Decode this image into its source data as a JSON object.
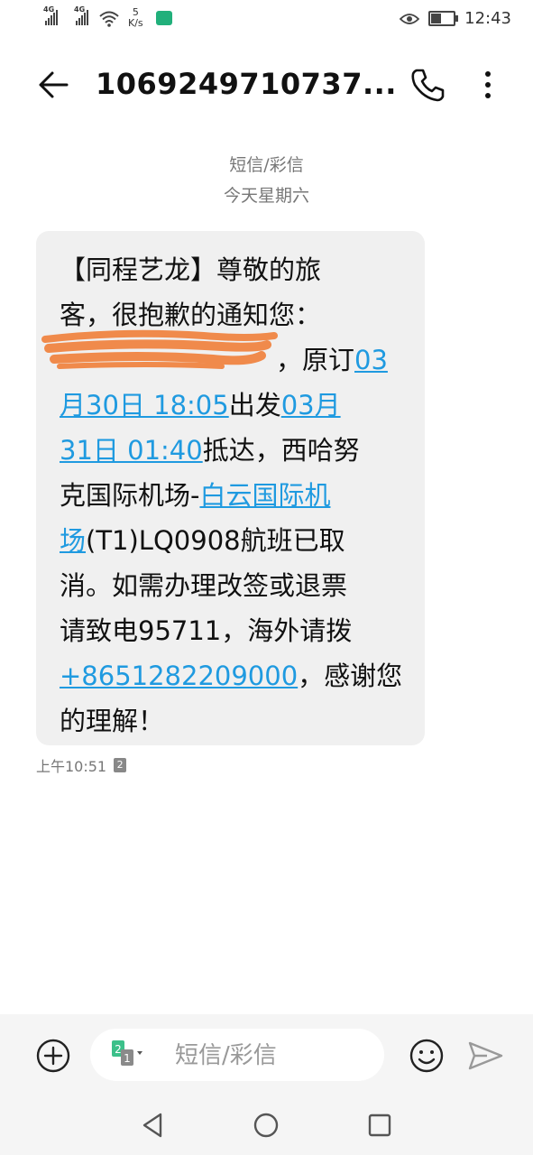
{
  "status_bar": {
    "sim1_network": "4G",
    "sim2_network": "4G",
    "speed_value": "5",
    "speed_unit": "K/s",
    "time": "12:43"
  },
  "header": {
    "title": "1069249710737..."
  },
  "conversation": {
    "type_label": "短信/彩信",
    "date_label": "今天星期六",
    "message": {
      "line1": "【同程艺龙】尊敬的旅",
      "line2": "客，很抱歉的通知您：",
      "line3_text": "，原订",
      "link_dep_a": "03",
      "link_dep_b": "月30日 18:05",
      "text_depart": "出发",
      "link_arr_a": "03月",
      "link_arr_b": "31日 01:40",
      "text_after_arr": "抵达，西哈努",
      "text_airport_pre": "克国际机场-",
      "link_airport_a": "白云国际机",
      "link_airport_b": "场",
      "text_flight": "(T1)LQ0908航班已取",
      "line_cancel": "消。如需办理改签或退票",
      "line_phone": "请致电95711，海外请拨",
      "link_intl_phone": "+8651282209000",
      "text_thanks": "，感谢您",
      "line_end": "的理解！"
    },
    "time": "上午10:51",
    "sim_badge": "2"
  },
  "composer": {
    "placeholder": "短信/彩信",
    "sim_switch_label": "2",
    "sim_switch_sub": "1"
  },
  "colors": {
    "link": "#1f9ae0",
    "bubble": "#f0f0f0",
    "redaction": "#f08a4b",
    "sim_green": "#3cc08a"
  }
}
